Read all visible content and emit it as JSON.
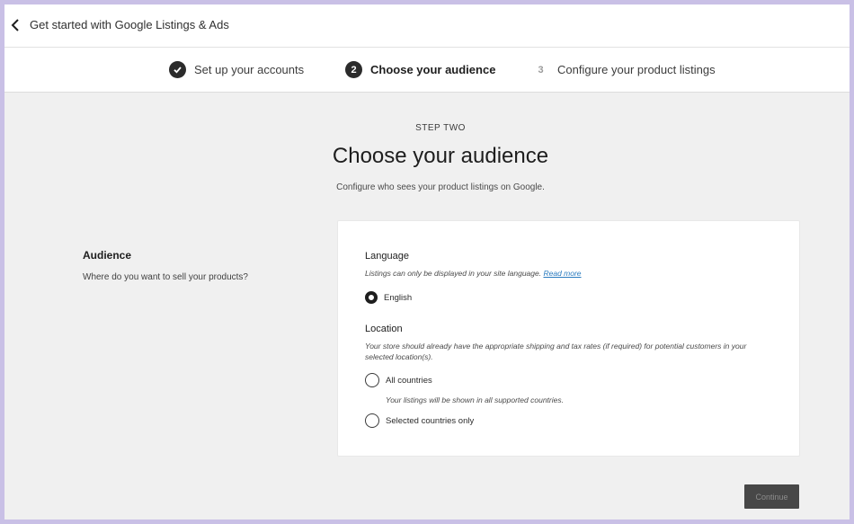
{
  "header": {
    "back_icon": "chevron-left-icon",
    "title": "Get started with Google Listings & Ads"
  },
  "stepper": {
    "steps": [
      {
        "number": "",
        "label": "Set up your accounts",
        "status": "complete",
        "icon": "checkmark-icon"
      },
      {
        "number": "2",
        "label": "Choose your audience",
        "status": "current"
      },
      {
        "number": "3",
        "label": "Configure your product listings",
        "status": "pending"
      }
    ]
  },
  "main": {
    "eyebrow": "STEP TWO",
    "title": "Choose your audience",
    "subtitle": "Configure who sees your product listings on Google."
  },
  "audience_section": {
    "heading": "Audience",
    "help": "Where do you want to sell your products?"
  },
  "card": {
    "language": {
      "label": "Language",
      "help": "Listings can only be displayed in your site language.",
      "link": "Read more",
      "options": [
        {
          "label": "English",
          "selected": true
        }
      ]
    },
    "location": {
      "label": "Location",
      "help": "Your store should already have the appropriate shipping and tax rates (if required) for potential customers in your selected location(s).",
      "options": [
        {
          "label": "All countries",
          "description": "Your listings will be shown in all supported countries.",
          "selected": false
        },
        {
          "label": "Selected countries only",
          "description": "",
          "selected": false
        }
      ]
    }
  },
  "footer": {
    "continue_label": "Continue",
    "continue_disabled": true
  },
  "colors": {
    "frame_border": "#c9c0e6",
    "background": "#f0f0f0",
    "link": "#2a7bbf",
    "dark": "#1e1e1e",
    "button_disabled": "#474747"
  }
}
